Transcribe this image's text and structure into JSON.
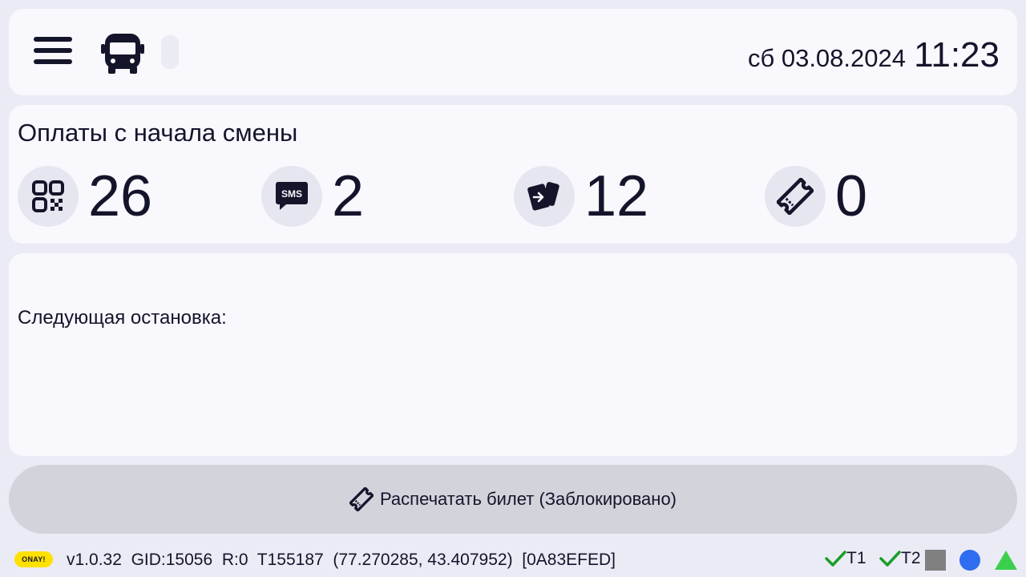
{
  "header": {
    "date": "сб 03.08.2024",
    "time": "11:23"
  },
  "stats": {
    "title": "Оплаты с начала смены",
    "items": [
      {
        "icon": "qr-code-icon",
        "value": "26"
      },
      {
        "icon": "sms-icon",
        "value": "2"
      },
      {
        "icon": "card-payment-icon",
        "value": "12"
      },
      {
        "icon": "ticket-icon",
        "value": "0"
      }
    ]
  },
  "next_stop": {
    "label": "Следующая остановка:"
  },
  "print_button": {
    "label": "Распечатать билет (Заблокировано)"
  },
  "statusbar": {
    "logo": "ONAY!",
    "version": "v1.0.32",
    "gid": "GID:15056",
    "r": "R:0",
    "terminal": "T155187",
    "coords": "(77.270285, 43.407952)",
    "device": "[0A83EFED]",
    "t1": "T1",
    "t2": "T2",
    "colors": {
      "check": "#1a9e2a",
      "square": "#808080",
      "dot": "#2e6cf0",
      "triangle": "#3ccf4e"
    }
  }
}
